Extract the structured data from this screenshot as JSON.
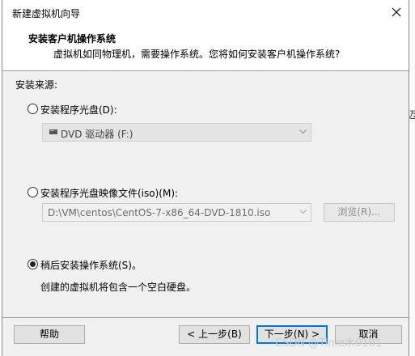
{
  "window": {
    "title": "新建虚拟机向导"
  },
  "header": {
    "title": "安装客户机操作系统",
    "subtitle": "虚拟机如同物理机，需要操作系统。您将如何安装客户机操作系统?"
  },
  "source_label": "安装来源:",
  "options": {
    "disc": {
      "label": "安装程序光盘(D):",
      "selected": false,
      "drive_value": "DVD 驱动器 (F:)"
    },
    "iso": {
      "label": "安装程序光盘映像文件(iso)(M):",
      "selected": false,
      "path_value": "D:\\VM\\centos\\CentOS-7-x86_64-DVD-1810.iso",
      "browse_label": "浏览(R)..."
    },
    "later": {
      "label": "稍后安装操作系统(S)。",
      "selected": true,
      "note": "创建的虚拟机将包含一个空白硬盘。"
    }
  },
  "buttons": {
    "help": "帮助",
    "back": "< 上一步(B)",
    "next": "下一步(N) >",
    "cancel": "取消"
  },
  "background": {
    "partial_char": "迈"
  },
  "watermark": "CSDN @Time木0101",
  "icons": [
    "close-icon",
    "dvd-drive-icon",
    "chevron-down-icon"
  ]
}
